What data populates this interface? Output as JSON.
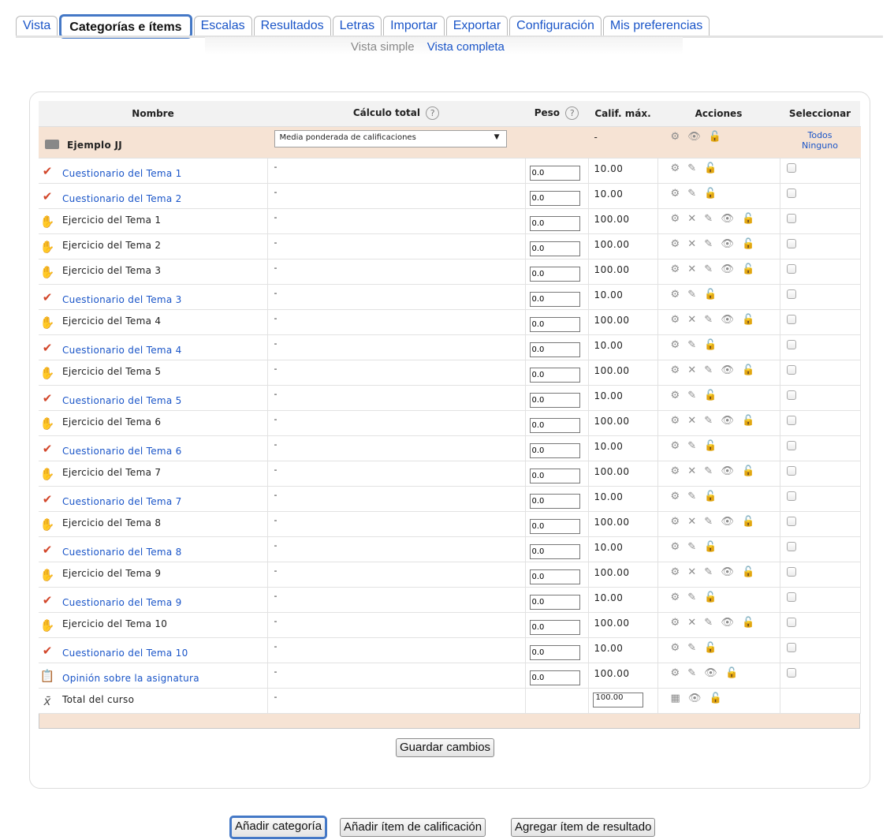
{
  "tabs": [
    {
      "label": "Vista",
      "active": false
    },
    {
      "label": "Categorías e ítems",
      "active": true
    },
    {
      "label": "Escalas",
      "active": false
    },
    {
      "label": "Resultados",
      "active": false
    },
    {
      "label": "Letras",
      "active": false
    },
    {
      "label": "Importar",
      "active": false
    },
    {
      "label": "Exportar",
      "active": false
    },
    {
      "label": "Configuración",
      "active": false
    },
    {
      "label": "Mis preferencias",
      "active": false
    }
  ],
  "subnav": {
    "simple": "Vista simple",
    "full": "Vista completa"
  },
  "table": {
    "headers": {
      "name": "Nombre",
      "calc": "Cálculo total",
      "weight": "Peso",
      "max": "Calif. máx.",
      "actions": "Acciones",
      "select": "Seleccionar"
    },
    "help_glyph": "?",
    "category": {
      "name": "Ejemplo JJ",
      "calc_option": "Media ponderada de calificaciones",
      "max": "-",
      "select_all": "Todos",
      "select_none": "Ninguno"
    },
    "items": [
      {
        "name": "Cuestionario del Tema 1",
        "type": "quiz",
        "calc": "-",
        "weight": "0.0",
        "max": "10.00",
        "actions": "⚙ ✎ 🔓"
      },
      {
        "name": "Cuestionario del Tema 2",
        "type": "quiz",
        "calc": "-",
        "weight": "0.0",
        "max": "10.00",
        "actions": "⚙ ✎ 🔓"
      },
      {
        "name": "Ejercicio del Tema 1",
        "type": "assign",
        "calc": "-",
        "weight": "0.0",
        "max": "100.00",
        "actions": "⚙ ✕ ✎ 👁 🔓"
      },
      {
        "name": "Ejercicio del Tema 2",
        "type": "assign",
        "calc": "-",
        "weight": "0.0",
        "max": "100.00",
        "actions": "⚙ ✕ ✎ 👁 🔓"
      },
      {
        "name": "Ejercicio del Tema 3",
        "type": "assign",
        "calc": "-",
        "weight": "0.0",
        "max": "100.00",
        "actions": "⚙ ✕ ✎ 👁 🔓"
      },
      {
        "name": "Cuestionario del Tema 3",
        "type": "quiz",
        "calc": "-",
        "weight": "0.0",
        "max": "10.00",
        "actions": "⚙ ✎ 🔓"
      },
      {
        "name": "Ejercicio del Tema 4",
        "type": "assign",
        "calc": "-",
        "weight": "0.0",
        "max": "100.00",
        "actions": "⚙ ✕ ✎ 👁 🔓"
      },
      {
        "name": "Cuestionario del Tema 4",
        "type": "quiz",
        "calc": "-",
        "weight": "0.0",
        "max": "10.00",
        "actions": "⚙ ✎ 🔓"
      },
      {
        "name": "Ejercicio del Tema 5",
        "type": "assign",
        "calc": "-",
        "weight": "0.0",
        "max": "100.00",
        "actions": "⚙ ✕ ✎ 👁 🔓"
      },
      {
        "name": "Cuestionario del Tema 5",
        "type": "quiz",
        "calc": "-",
        "weight": "0.0",
        "max": "10.00",
        "actions": "⚙ ✎ 🔓"
      },
      {
        "name": "Ejercicio del Tema 6",
        "type": "assign",
        "calc": "-",
        "weight": "0.0",
        "max": "100.00",
        "actions": "⚙ ✕ ✎ 👁 🔓"
      },
      {
        "name": "Cuestionario del Tema 6",
        "type": "quiz",
        "calc": "-",
        "weight": "0.0",
        "max": "10.00",
        "actions": "⚙ ✎ 🔓"
      },
      {
        "name": "Ejercicio del Tema 7",
        "type": "assign",
        "calc": "-",
        "weight": "0.0",
        "max": "100.00",
        "actions": "⚙ ✕ ✎ 👁 🔓"
      },
      {
        "name": "Cuestionario del Tema 7",
        "type": "quiz",
        "calc": "-",
        "weight": "0.0",
        "max": "10.00",
        "actions": "⚙ ✎ 🔓"
      },
      {
        "name": "Ejercicio del Tema 8",
        "type": "assign",
        "calc": "-",
        "weight": "0.0",
        "max": "100.00",
        "actions": "⚙ ✕ ✎ 👁 🔓"
      },
      {
        "name": "Cuestionario del Tema 8",
        "type": "quiz",
        "calc": "-",
        "weight": "0.0",
        "max": "10.00",
        "actions": "⚙ ✎ 🔓"
      },
      {
        "name": "Ejercicio del Tema 9",
        "type": "assign",
        "calc": "-",
        "weight": "0.0",
        "max": "100.00",
        "actions": "⚙ ✕ ✎ 👁 🔓"
      },
      {
        "name": "Cuestionario del Tema 9",
        "type": "quiz",
        "calc": "-",
        "weight": "0.0",
        "max": "10.00",
        "actions": "⚙ ✎ 🔓"
      },
      {
        "name": "Ejercicio del Tema 10",
        "type": "assign",
        "calc": "-",
        "weight": "0.0",
        "max": "100.00",
        "actions": "⚙ ✕ ✎ 👁 🔓"
      },
      {
        "name": "Cuestionario del Tema 10",
        "type": "quiz",
        "calc": "-",
        "weight": "0.0",
        "max": "10.00",
        "actions": "⚙ ✎ 🔓"
      },
      {
        "name": "Opinión sobre la asignatura",
        "type": "feedback",
        "calc": "-",
        "weight": "0.0",
        "max": "100.00",
        "actions": "⚙ ✎ 👁 🔓"
      }
    ],
    "total": {
      "name": "Total del curso",
      "calc": "-",
      "max": "100.00",
      "actions": "▦ 👁 🔓"
    }
  },
  "buttons": {
    "save": "Guardar cambios",
    "add_category": "Añadir categoría",
    "add_grade_item": "Añadir ítem de calificación",
    "add_outcome_item": "Agregar ítem de resultado"
  }
}
